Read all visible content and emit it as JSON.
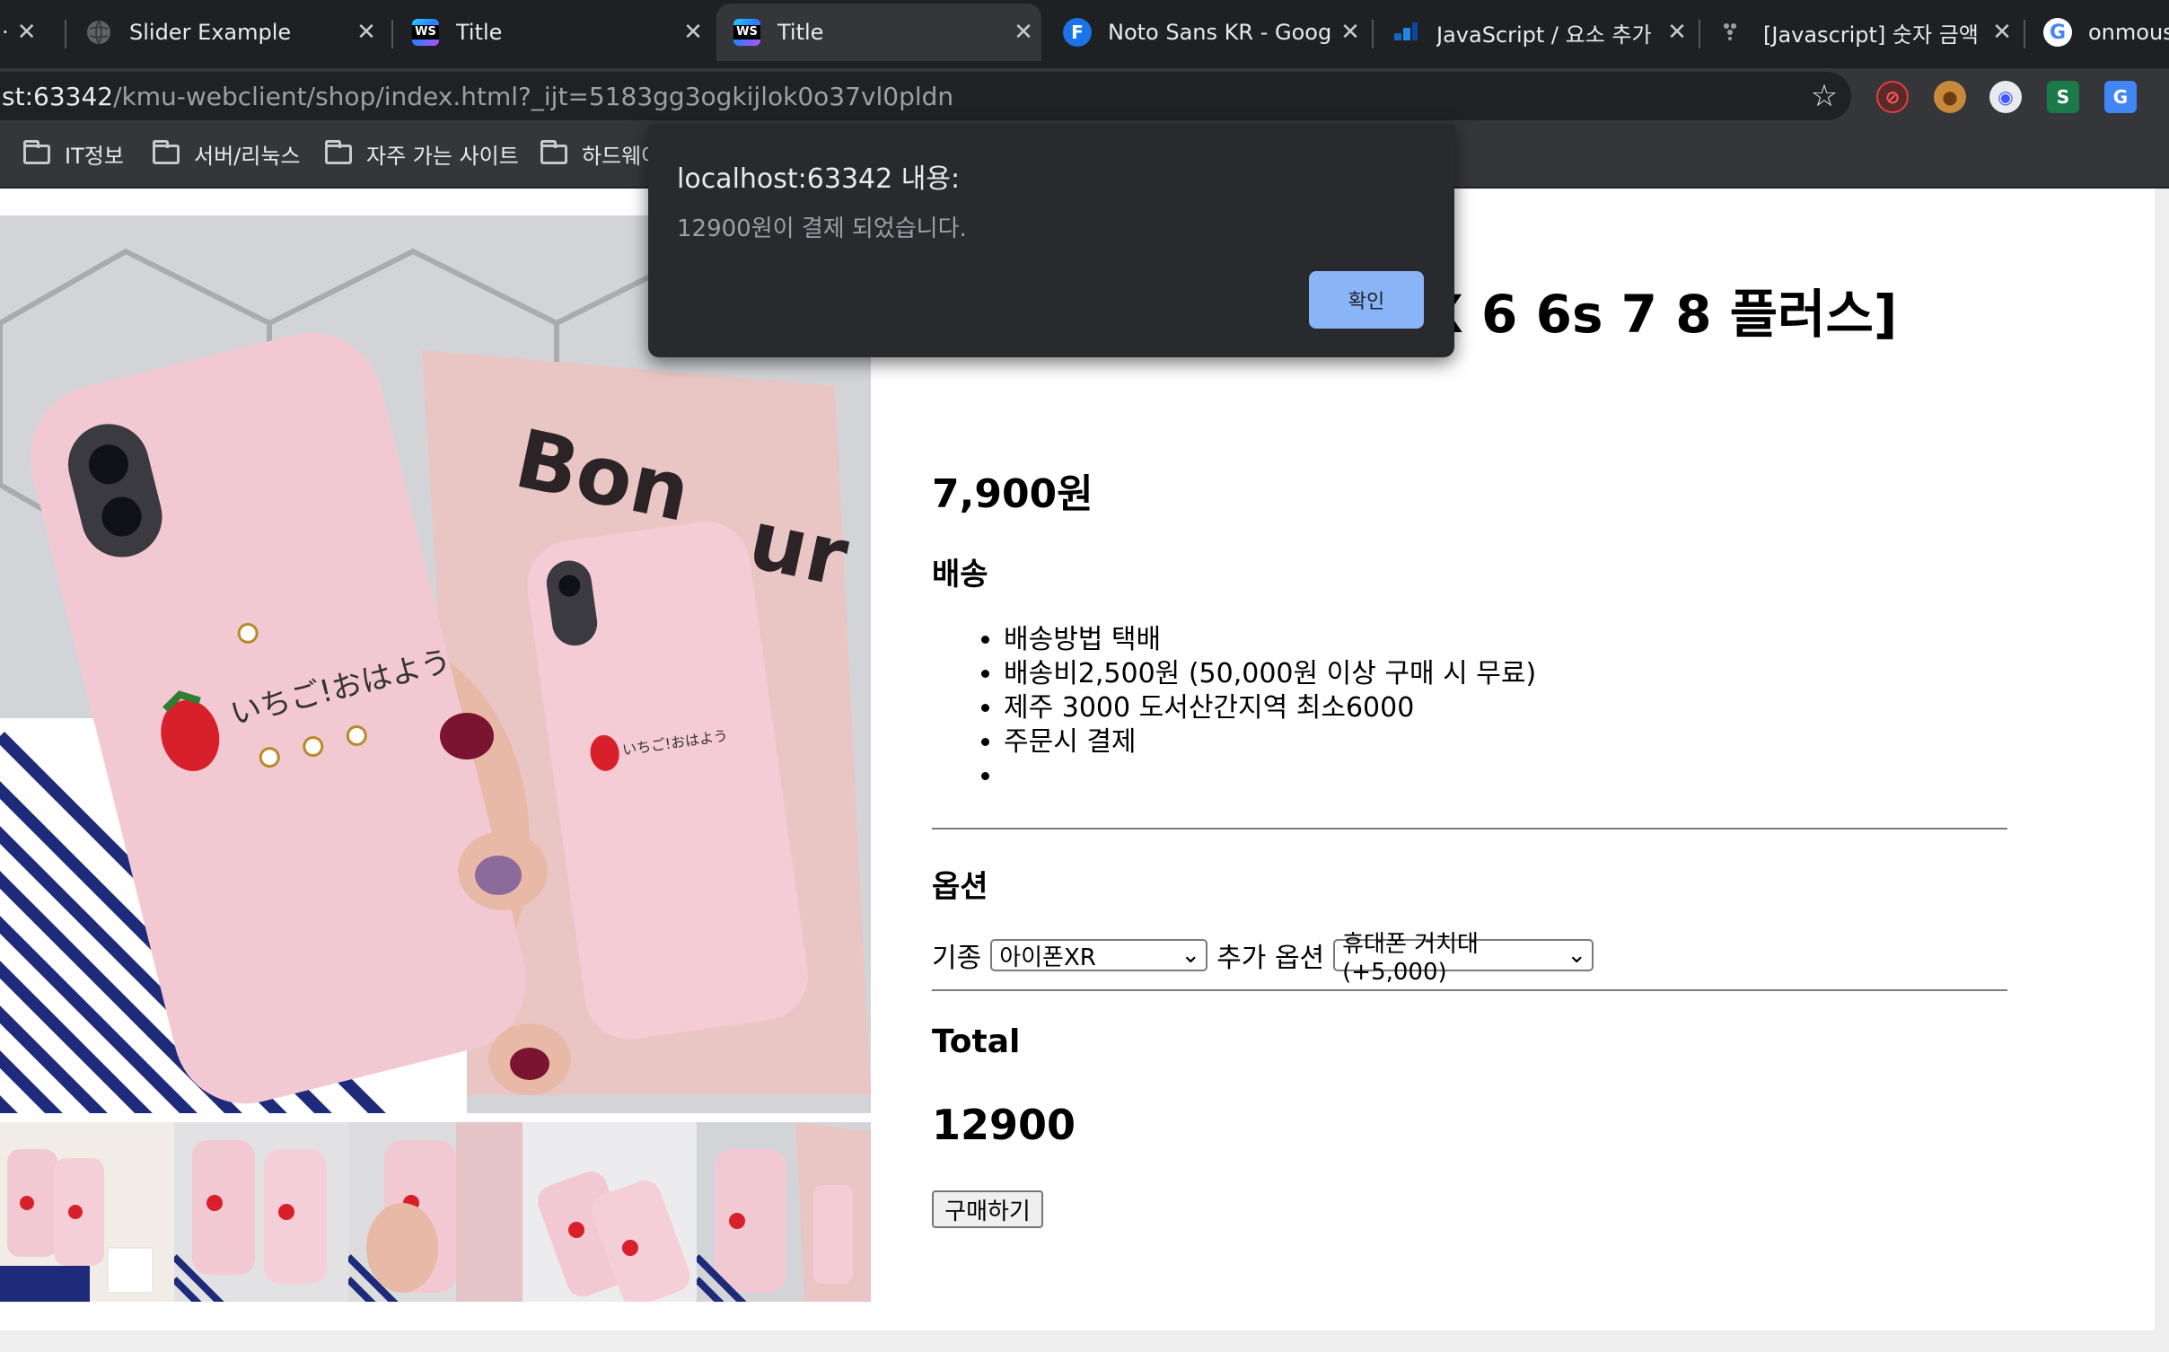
{
  "browser": {
    "tabs": [
      {
        "title": "",
        "icon": "partial-tab"
      },
      {
        "title": "Slider Example",
        "icon": "globe-icon"
      },
      {
        "title": "Title",
        "icon": "webstorm-icon"
      },
      {
        "title": "Title",
        "icon": "webstorm-icon",
        "active": true
      },
      {
        "title": "Noto Sans KR - Goog",
        "icon": "fonts-icon"
      },
      {
        "title": "JavaScript / 요소 추가",
        "icon": "site-icon"
      },
      {
        "title": "[Javascript] 숫자 금액",
        "icon": "site-icon"
      },
      {
        "title": "onmous",
        "icon": "google-icon"
      }
    ],
    "tab_close_glyph": "✕",
    "url": {
      "host_part": "st:63342",
      "path_part": "/kmu-webclient/shop/index.html?_ijt=5183gg3ogkijlok0o37vl0pldn"
    },
    "bookmarks": [
      "IT정보",
      "서버/리눅스",
      "자주 가는 사이트",
      "하드웨어"
    ]
  },
  "alert": {
    "title": "localhost:63342 내용:",
    "message": "12900원이 결제 되었습니다.",
    "ok_label": "확인"
  },
  "product": {
    "title": "딸기 폰케이스 [아이폰X 6 6s 7 8 플러스]",
    "price": "7,900원",
    "shipping_heading": "배송",
    "shipping_items": [
      "배송방법 택배",
      "배송비2,500원 (50,000원 이상 구매 시 무료)",
      "제주 3000 도서산간지역 최소6000",
      "주문시 결제",
      ""
    ],
    "options_heading": "옵션",
    "model_label": "기종",
    "model_selected": "아이폰XR",
    "extra_label": "추가 옵션",
    "extra_selected": "휴대폰 거치대(+5,000)",
    "total_heading": "Total",
    "total_value": "12900",
    "buy_label": "구매하기"
  },
  "colors": {
    "tabstrip": "#1f2023",
    "toolbar": "#35363a",
    "dialog_bg": "#292a2d",
    "dialog_button": "#8ab4f8",
    "phone_case_pink": "#f2c9d3"
  }
}
